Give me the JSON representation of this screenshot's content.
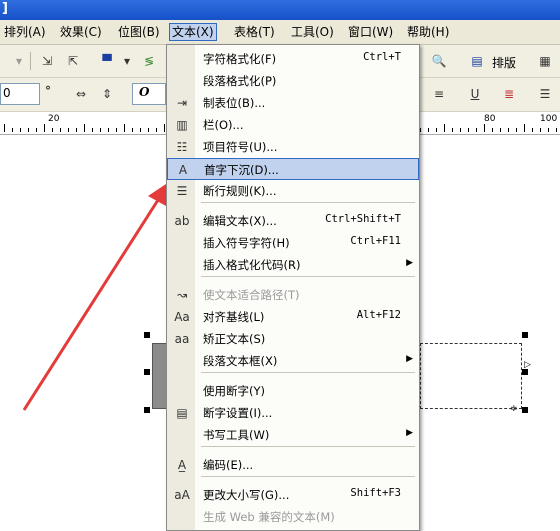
{
  "titlebar": {
    "title": "]"
  },
  "menubar": [
    {
      "label": "排列(A)",
      "active": false
    },
    {
      "label": "效果(C)",
      "active": false
    },
    {
      "label": "位图(B)",
      "active": false
    },
    {
      "label": "文本(X)",
      "active": true
    },
    {
      "label": "表格(T)",
      "active": false
    },
    {
      "label": "工具(O)",
      "active": false
    },
    {
      "label": "窗口(W)",
      "active": false
    },
    {
      "label": "帮助(H)",
      "active": false
    }
  ],
  "toolbar": {
    "typeset_label": "排版",
    "size_value": "0",
    "degree_symbol": "°",
    "font_glyph": "O"
  },
  "ruler": {
    "labels": [
      "20",
      "80",
      "100"
    ]
  },
  "text_menu": {
    "items": [
      {
        "label": "字符格式化(F)",
        "shortcut": "Ctrl+T",
        "icon": "",
        "submenu": false,
        "disabled": false,
        "highlight": false
      },
      {
        "label": "段落格式化(P)",
        "shortcut": "",
        "icon": "",
        "submenu": false,
        "disabled": false,
        "highlight": false
      },
      {
        "label": "制表位(B)...",
        "shortcut": "",
        "icon": "tab-stop-icon",
        "submenu": false,
        "disabled": false,
        "highlight": false
      },
      {
        "label": "栏(O)...",
        "shortcut": "",
        "icon": "columns-icon",
        "submenu": false,
        "disabled": false,
        "highlight": false
      },
      {
        "label": "项目符号(U)...",
        "shortcut": "",
        "icon": "bullets-icon",
        "submenu": false,
        "disabled": false,
        "highlight": false
      },
      {
        "label": "首字下沉(D)...",
        "shortcut": "",
        "icon": "drop-cap-icon",
        "submenu": false,
        "disabled": false,
        "highlight": true
      },
      {
        "label": "断行规则(K)...",
        "shortcut": "",
        "icon": "line-break-icon",
        "submenu": false,
        "disabled": false,
        "highlight": false
      },
      {
        "label": "编辑文本(X)...",
        "shortcut": "Ctrl+Shift+T",
        "icon": "edit-text-icon",
        "submenu": false,
        "disabled": false,
        "highlight": false
      },
      {
        "label": "插入符号字符(H)",
        "shortcut": "Ctrl+F11",
        "icon": "",
        "submenu": false,
        "disabled": false,
        "highlight": false
      },
      {
        "label": "插入格式化代码(R)",
        "shortcut": "",
        "icon": "",
        "submenu": true,
        "disabled": false,
        "highlight": false
      },
      {
        "label": "使文本适合路径(T)",
        "shortcut": "",
        "icon": "fit-path-icon",
        "submenu": false,
        "disabled": true,
        "highlight": false
      },
      {
        "label": "对齐基线(L)",
        "shortcut": "Alt+F12",
        "icon": "align-baseline-icon",
        "submenu": false,
        "disabled": false,
        "highlight": false
      },
      {
        "label": "矫正文本(S)",
        "shortcut": "",
        "icon": "straighten-text-icon",
        "submenu": false,
        "disabled": false,
        "highlight": false
      },
      {
        "label": "段落文本框(X)",
        "shortcut": "",
        "icon": "",
        "submenu": true,
        "disabled": false,
        "highlight": false
      },
      {
        "label": "使用断字(Y)",
        "shortcut": "",
        "icon": "",
        "submenu": false,
        "disabled": false,
        "highlight": false
      },
      {
        "label": "断字设置(I)...",
        "shortcut": "",
        "icon": "hyphenation-icon",
        "submenu": false,
        "disabled": false,
        "highlight": false
      },
      {
        "label": "书写工具(W)",
        "shortcut": "",
        "icon": "",
        "submenu": true,
        "disabled": false,
        "highlight": false
      },
      {
        "label": "编码(E)...",
        "shortcut": "",
        "icon": "encoding-icon",
        "submenu": false,
        "disabled": false,
        "highlight": false
      },
      {
        "label": "更改大小写(G)...",
        "shortcut": "Shift+F3",
        "icon": "change-case-icon",
        "submenu": false,
        "disabled": false,
        "highlight": false
      },
      {
        "label": "生成 Web 兼容的文本(M)",
        "shortcut": "",
        "icon": "",
        "submenu": false,
        "disabled": true,
        "highlight": false
      }
    ]
  },
  "colors": {
    "menu_highlight": "#c1d2ee",
    "menu_highlight_border": "#316ac5",
    "arrow": "#e53a3a",
    "titlebar": "#1f5fd6"
  }
}
